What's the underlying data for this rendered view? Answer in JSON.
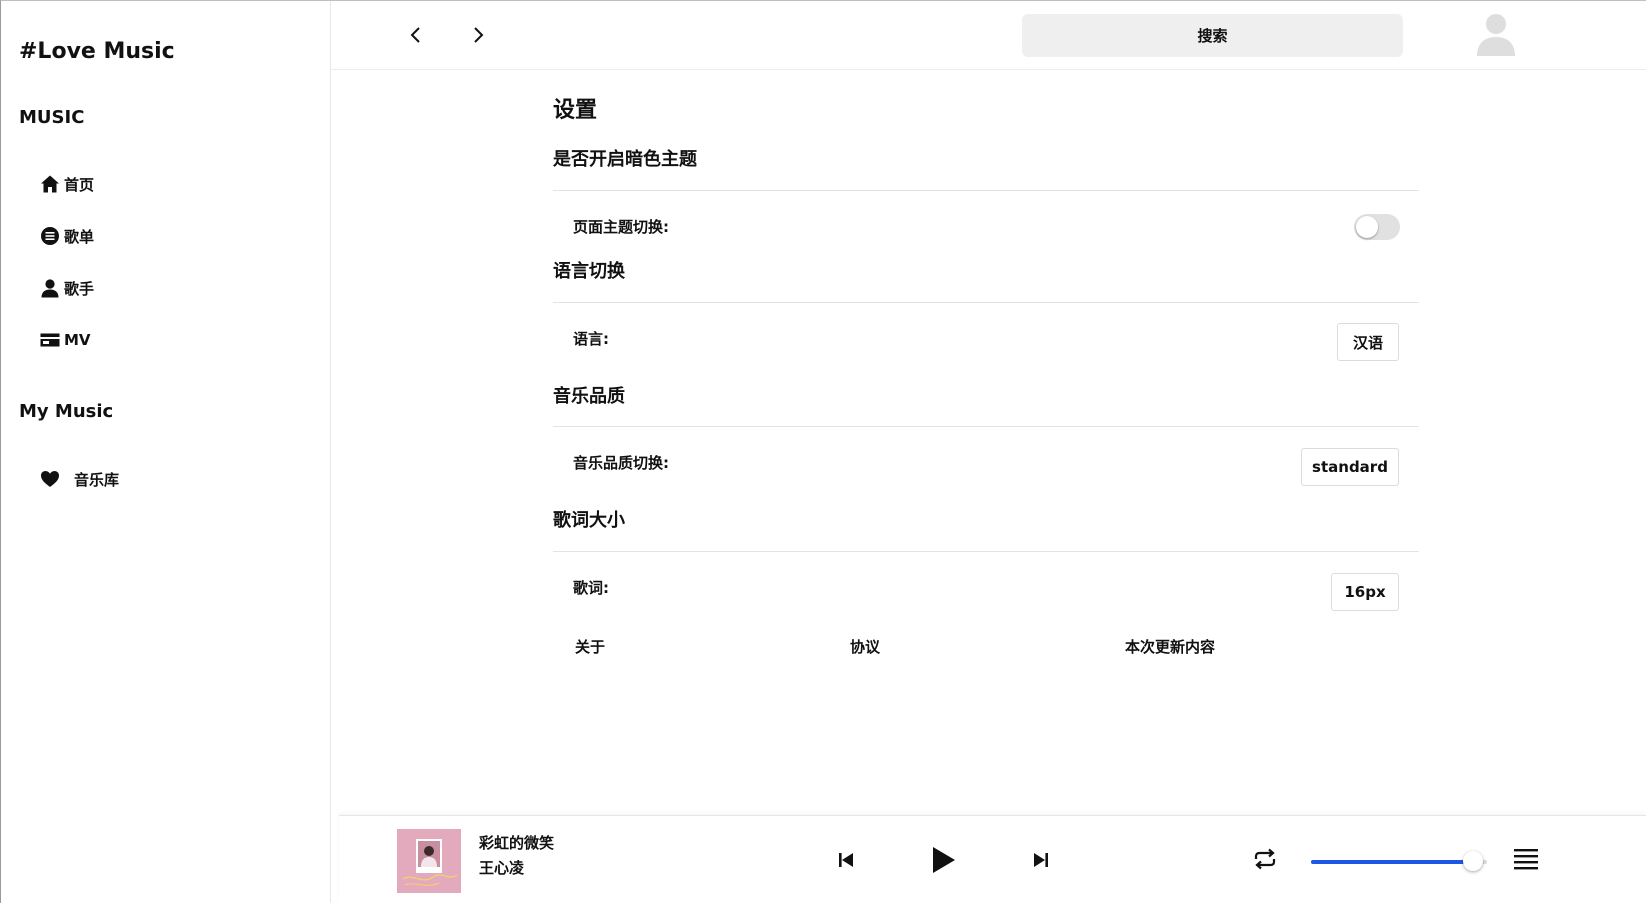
{
  "sidebar": {
    "brand": "#Love Music",
    "music_section": "MUSIC",
    "music_items": [
      {
        "label": "首页",
        "icon": "home-icon"
      },
      {
        "label": "歌单",
        "icon": "playlist-icon"
      },
      {
        "label": "歌手",
        "icon": "person-icon"
      },
      {
        "label": "MV",
        "icon": "mv-icon"
      }
    ],
    "my_section": "My Music",
    "my_items": [
      {
        "label": "音乐库",
        "icon": "heart-icon"
      }
    ]
  },
  "topbar": {
    "search_placeholder": "搜索"
  },
  "settings": {
    "title": "设置",
    "theme": {
      "heading": "是否开启暗色主题",
      "label": "页面主题切换:",
      "enabled": false
    },
    "language": {
      "heading": "语言切换",
      "label": "语言:",
      "value": "汉语"
    },
    "quality": {
      "heading": "音乐品质",
      "label": "音乐品质切换:",
      "value": "standard"
    },
    "lyrics": {
      "heading": "歌词大小",
      "label": "歌词:",
      "value": "16px"
    },
    "links": {
      "about": "关于",
      "agreement": "协议",
      "changelog": "本次更新内容"
    }
  },
  "player": {
    "song_title": "彩虹的微笑",
    "artist": "王心凌",
    "volume_fraction": 0.92,
    "colors": {
      "accent": "#1e56e6",
      "cover_bg": "#e3a9bd"
    }
  }
}
